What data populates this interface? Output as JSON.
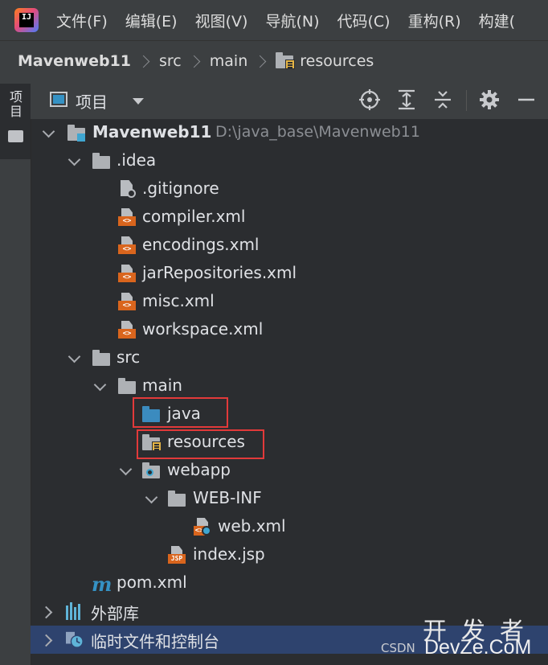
{
  "menubar": {
    "logo_text": "IJ",
    "items": [
      "文件(F)",
      "编辑(E)",
      "视图(V)",
      "导航(N)",
      "代码(C)",
      "重构(R)",
      "构建("
    ]
  },
  "breadcrumb": [
    "Mavenweb11",
    "src",
    "main",
    "resources"
  ],
  "sidebar": {
    "tab_label": "项目"
  },
  "tool_window": {
    "title": "项目",
    "actions": [
      "locate-icon",
      "expand-all-icon",
      "collapse-all-icon",
      "settings-icon",
      "hide-icon"
    ]
  },
  "tree": {
    "root_name": "Mavenweb11",
    "root_path": "D:\\java_base\\Mavenweb11",
    "idea": ".idea",
    "gitignore": ".gitignore",
    "compiler": "compiler.xml",
    "encodings": "encodings.xml",
    "jar_repos": "jarRepositories.xml",
    "misc": "misc.xml",
    "workspace": "workspace.xml",
    "src": "src",
    "main": "main",
    "java": "java",
    "resources": "resources",
    "webapp": "webapp",
    "webinf": "WEB-INF",
    "webxml": "web.xml",
    "indexjsp": "index.jsp",
    "pom": "pom.xml",
    "ext_libs": "外部库",
    "scratches": "临时文件和控制台"
  },
  "icons": {
    "xml_tag": "<>",
    "jsp_tag": "JSP",
    "maven": "m"
  },
  "watermark": {
    "csdn": "CSDN",
    "big": "开发者",
    "site": "DevZe.CoM"
  },
  "colors": {
    "accent": "#2e436e",
    "highlight_box": "#e23a3a",
    "folder_source": "#3b8bbf",
    "xml_badge": "#d9651d"
  }
}
